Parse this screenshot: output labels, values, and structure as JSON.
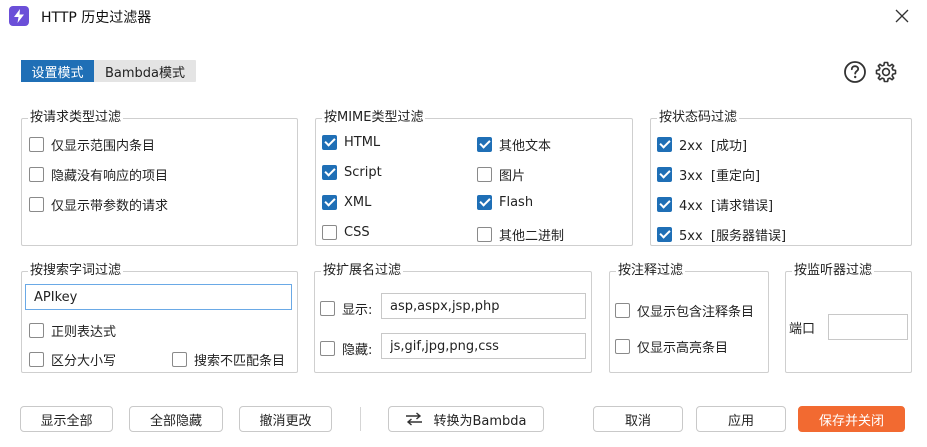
{
  "window": {
    "title": "HTTP 历史过滤器"
  },
  "mode": {
    "settings_label": "设置模式",
    "bambda_label": "Bambda模式",
    "active": "settings"
  },
  "icons": {
    "app": "lightning-icon",
    "help": "help-icon",
    "settings": "gear-icon",
    "close": "close-icon"
  },
  "request_type": {
    "title": "按请求类型过滤",
    "items": [
      {
        "label": "仅显示范围内条目",
        "checked": false
      },
      {
        "label": "隐藏没有响应的项目",
        "checked": false
      },
      {
        "label": "仅显示带参数的请求",
        "checked": false
      }
    ]
  },
  "mime": {
    "title": "按MIME类型过滤",
    "items": [
      {
        "label": "HTML",
        "checked": true
      },
      {
        "label": "Script",
        "checked": true
      },
      {
        "label": "XML",
        "checked": true
      },
      {
        "label": "CSS",
        "checked": false
      },
      {
        "label": "其他文本",
        "checked": true
      },
      {
        "label": "图片",
        "checked": false
      },
      {
        "label": "Flash",
        "checked": true
      },
      {
        "label": "其他二进制",
        "checked": false
      }
    ]
  },
  "status": {
    "title": "按状态码过滤",
    "items": [
      {
        "label": "2xx  [成功]",
        "checked": true
      },
      {
        "label": "3xx  [重定向]",
        "checked": true
      },
      {
        "label": "4xx  [请求错误]",
        "checked": true
      },
      {
        "label": "5xx  [服务器错误]",
        "checked": true
      }
    ]
  },
  "search": {
    "title": "按搜索字词过滤",
    "value": "APIkey",
    "regex_label": "正则表达式",
    "regex_checked": false,
    "case_label": "区分大小写",
    "case_checked": false,
    "negate_label": "搜索不匹配条目",
    "negate_checked": false
  },
  "extension": {
    "title": "按扩展名过滤",
    "show_label": "显示:",
    "show_checked": false,
    "show_value": "asp,aspx,jsp,php",
    "hide_label": "隐藏:",
    "hide_checked": false,
    "hide_value": "js,gif,jpg,png,css"
  },
  "annotation": {
    "title": "按注释过滤",
    "items": [
      {
        "label": "仅显示包含注释条目",
        "checked": false
      },
      {
        "label": "仅显示高亮条目",
        "checked": false
      }
    ]
  },
  "listener": {
    "title": "按监听器过滤",
    "port_label": "端口",
    "port_value": ""
  },
  "buttons": {
    "show_all": "显示全部",
    "hide_all": "全部隐藏",
    "revert": "撤消更改",
    "convert": "转换为Bambda",
    "cancel": "取消",
    "apply": "应用",
    "save_close": "保存并关闭"
  },
  "colors": {
    "accent": "#1f6fb6",
    "primary_button": "#f26a31",
    "app_icon": "#6b4fd8"
  }
}
